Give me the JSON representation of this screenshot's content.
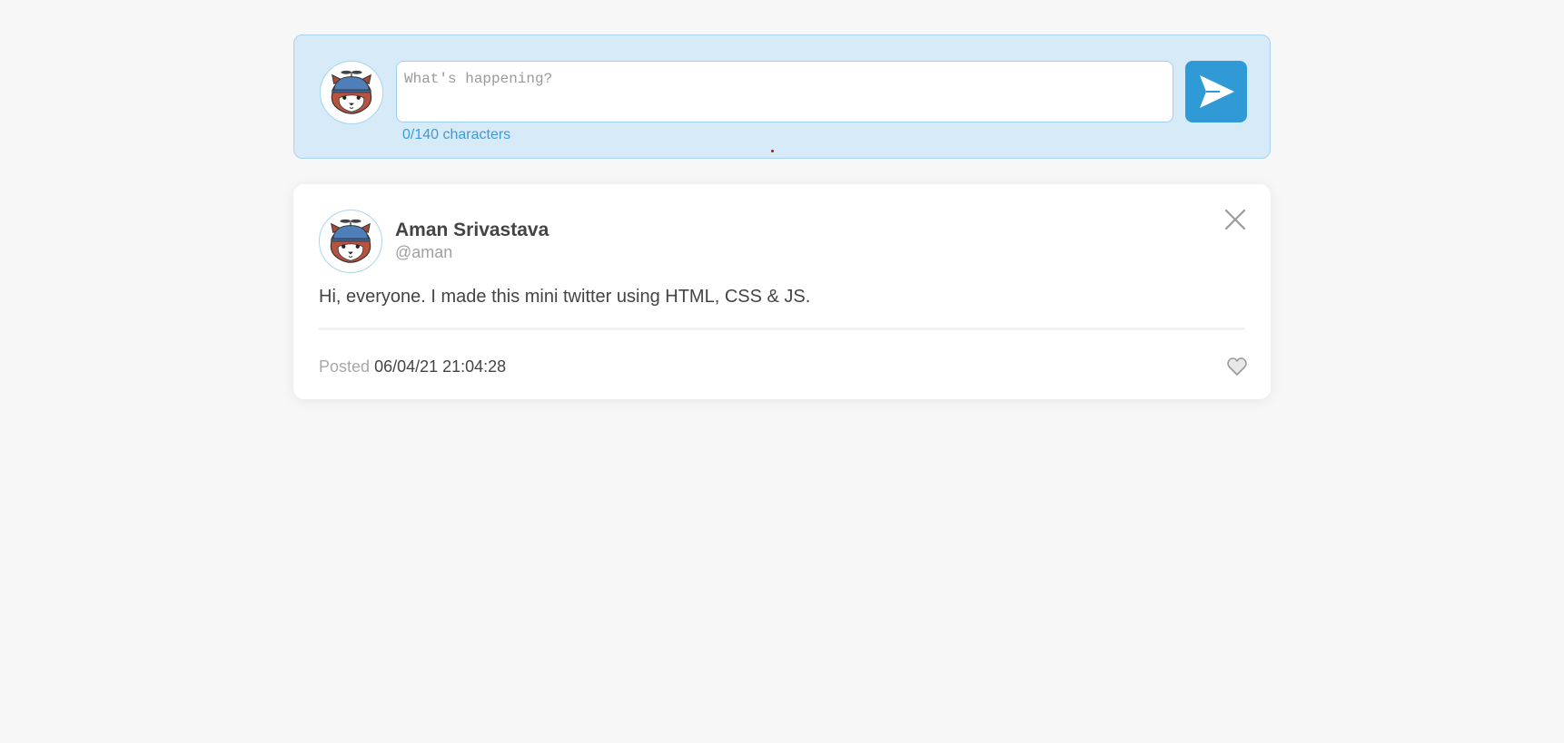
{
  "compose": {
    "placeholder": "What's happening?",
    "value": "",
    "char_counter": "0/140 characters",
    "send_icon": "send-arrow-icon",
    "avatar_icon": "red-panda-avatar"
  },
  "tweets": [
    {
      "name": "Aman Srivastava",
      "handle": "@aman",
      "text": "Hi, everyone. I made this mini twitter using HTML, CSS & JS.",
      "posted_label": "Posted",
      "posted_date": "06/04/21 21:04:28",
      "avatar_icon": "red-panda-avatar",
      "close_icon": "close-icon",
      "like_icon": "heart-icon",
      "liked": false
    }
  ],
  "colors": {
    "accent": "#2f9ad6",
    "compose_bg": "#d6eaf8",
    "page_bg": "#f7f7f7",
    "counter": "#3f9bd4"
  }
}
